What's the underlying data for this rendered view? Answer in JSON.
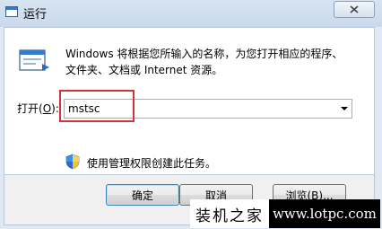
{
  "window": {
    "title": "运行",
    "close_icon": "close-icon",
    "app_icon": "run-window-icon"
  },
  "main": {
    "description_line1": "Windows 将根据您所输入的名称，为您打开相应的程序、",
    "description_line2": "文件夹、文档或 Internet 资源。",
    "open_label_prefix": "打开(",
    "open_label_accel": "O",
    "open_label_suffix": "):",
    "open_input_value": "mstsc",
    "admin_note": "使用管理权限创建此任务。",
    "run_icon": "run-program-icon",
    "shield_icon": "uac-shield-icon"
  },
  "buttons": {
    "ok": "确定",
    "cancel": "取消",
    "browse": "浏览(B)..."
  },
  "watermark": {
    "brand": "装机之家",
    "url": "www.lotpc.com"
  },
  "colors": {
    "highlight": "#d13438",
    "titlebar": "#c9d9ec",
    "watermark_bg": "#000000"
  }
}
